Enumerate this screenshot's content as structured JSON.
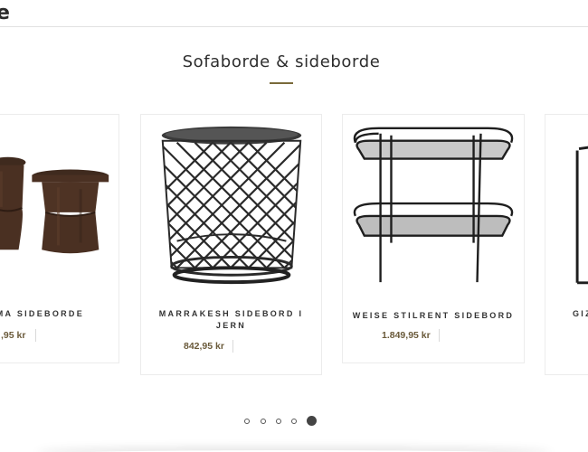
{
  "header": {
    "brand_fragment": "e"
  },
  "section": {
    "title": "Sofaborde & sideborde"
  },
  "products": [
    {
      "name": "ama sideborde",
      "price": ",95 kr",
      "image": "wooden-stools"
    },
    {
      "name": "Marrakesh sidebord i jern",
      "price": "842,95 kr",
      "image": "iron-lattice-side-table"
    },
    {
      "name": "Weise stilrent sidebord",
      "price": "1.849,95 kr",
      "image": "black-metal-trolley"
    },
    {
      "name": "Giz",
      "price": "",
      "image": "black-metal-frame-table"
    }
  ],
  "carousel": {
    "pages": 5,
    "active_page": 5
  },
  "colors": {
    "accent": "#7a6a3a",
    "price": "#6a5a3a",
    "text": "#2e2e2e",
    "card_border": "#ececec"
  }
}
